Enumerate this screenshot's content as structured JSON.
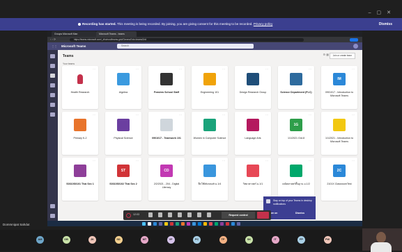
{
  "banner": {
    "message_bold": "Recording has started.",
    "message": "This meeting is being recorded. By joining, you are giving consent for this meeting to be recorded.",
    "privacy_link": "Privacy policy",
    "dismiss": "Dismiss"
  },
  "window_controls": {
    "minimize": "–",
    "maximize": "▢",
    "close": "✕"
  },
  "browser": {
    "tabs": [
      "Groups Microsoft Man",
      "Microsoft Teams - teams"
    ],
    "url": "https://teams.microsoft.com/_#/school/teams-grid/General?ctx=teamsGrid"
  },
  "teams": {
    "app_name": "Microsoft Teams",
    "search_placeholder": "Search",
    "title": "Teams",
    "join_button": "Join or create team",
    "section_label": "Your teams",
    "cards": [
      {
        "name": "Health Research",
        "bold": false,
        "color": "#ffffff",
        "tile_text": "",
        "glyph_color": "#c4314b"
      },
      {
        "name": "Algebra",
        "bold": false,
        "color": "#3b9adf",
        "tile_text": ""
      },
      {
        "name": "Peaview School Staff",
        "bold": true,
        "color": "#333333",
        "tile_text": ""
      },
      {
        "name": "Engineering 101",
        "bold": false,
        "color": "#f0a30a",
        "tile_text": ""
      },
      {
        "name": "Design Research Group",
        "bold": false,
        "color": "#1f4e79",
        "tile_text": ""
      },
      {
        "name": "Science Department (PLC)",
        "bold": true,
        "color": "#2e6b9e",
        "tile_text": ""
      },
      {
        "name": "0901017 - Introduction to Microsoft Teams",
        "bold": false,
        "color": "#2b88d8",
        "tile_text": "IM"
      },
      {
        "name": "Primary K-2",
        "bold": false,
        "color": "#e8742b",
        "tile_text": ""
      },
      {
        "name": "Physical Science",
        "bold": false,
        "color": "#6b3fa0",
        "tile_text": ""
      },
      {
        "name": "0901017 - Teamwork 101",
        "bold": true,
        "color": "#cfd6dc",
        "tile_text": ""
      },
      {
        "name": "Women in Computer Science",
        "bold": false,
        "color": "#1aa37a",
        "tile_text": ""
      },
      {
        "name": "Language Arts",
        "bold": false,
        "color": "#b4195e",
        "tile_text": ""
      },
      {
        "name": "1/1/2021 Grd.8",
        "bold": false,
        "color": "#2e9e4a",
        "tile_text": "1G"
      },
      {
        "name": "1/1/2021 - Introduction to Microsoft Teams",
        "bold": false,
        "color": "#f2c811",
        "tile_text": ""
      },
      {
        "name": "S0310S0101 Thai Sec 1",
        "bold": true,
        "color": "#8e3f99",
        "tile_text": ""
      },
      {
        "name": "S0310S0102 Thai Sec 2",
        "bold": true,
        "color": "#d13438",
        "tile_text": "ST"
      },
      {
        "name": "2/2/2021 - 204 - Digital Literacy",
        "bold": false,
        "color": "#c239b3",
        "tile_text": "CD"
      },
      {
        "name": "ฝึกใช้Microsoft ม.1/4",
        "bold": false,
        "color": "#3a96dd",
        "tile_text": ""
      },
      {
        "name": "วิทยาศาสตร์ ม.1/1",
        "bold": false,
        "color": "#e74856",
        "tile_text": ""
      },
      {
        "name": "คณิตศาสตร์พื้นฐาน ม.1/2",
        "bold": false,
        "color": "#00a86b",
        "tile_text": ""
      },
      {
        "name": "2101X ClassroomTest",
        "bold": false,
        "color": "#2b88d8",
        "tile_text": "2C"
      }
    ]
  },
  "notification": {
    "text": "Stay on top of your Teams in desktop notifications",
    "turn_on": "Turn on",
    "dismiss": "Dismiss"
  },
  "meeting_controls": {
    "timer": "12:03",
    "request_control": "Request control"
  },
  "presenter_label": "Dommnipat Sahdut",
  "participants": [
    "AM",
    "OB",
    "JK",
    "SD",
    "MT",
    "VP",
    "PC",
    "TP",
    "SK",
    "IT",
    "FP",
    "PW"
  ],
  "participant_colors": [
    "#6ea6c9",
    "#c9e2a9",
    "#f0c6b9",
    "#f4d08f",
    "#e6a8c8",
    "#d6c3ea",
    "#a9d0e6",
    "#f4b183",
    "#c9e2a9",
    "#e6a8c8",
    "#a9d0e6",
    "#f0c6b9"
  ]
}
